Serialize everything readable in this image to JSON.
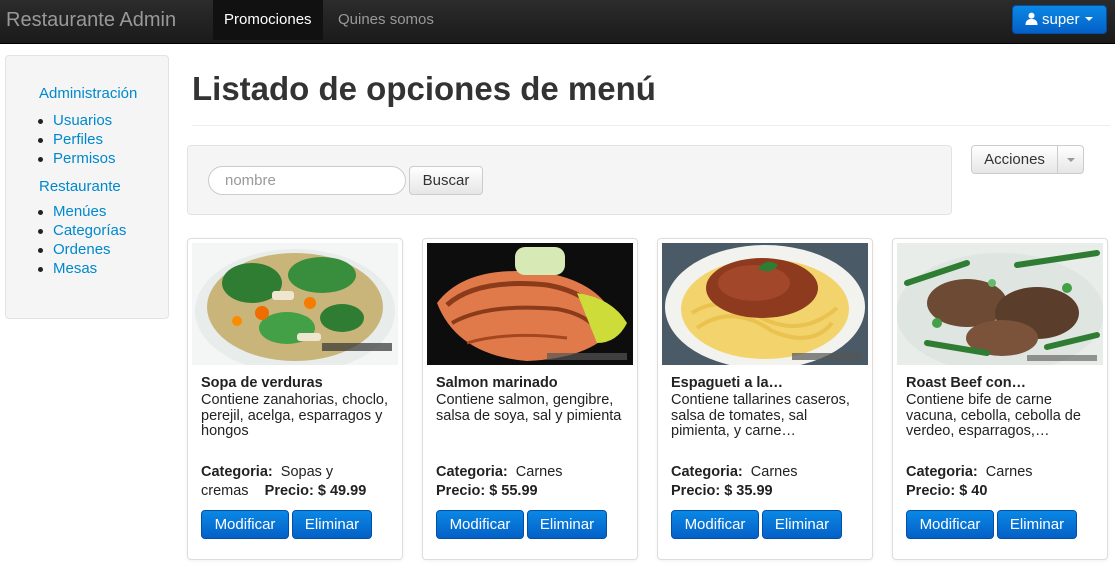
{
  "navbar": {
    "brand": "Restaurante Admin",
    "tabs": [
      {
        "label": "Promociones",
        "active": true
      },
      {
        "label": "Quines somos",
        "active": false
      }
    ],
    "user": "super"
  },
  "sidebar": {
    "sections": [
      {
        "header": "Administración",
        "items": [
          "Usuarios",
          "Perfiles",
          "Permisos"
        ]
      },
      {
        "header": "Restaurante",
        "items": [
          "Menúes",
          "Categorías",
          "Ordenes",
          "Mesas"
        ]
      }
    ]
  },
  "main": {
    "title": "Listado de opciones de menú",
    "search": {
      "placeholder": "nombre",
      "value": "",
      "button": "Buscar"
    },
    "actions_label": "Acciones",
    "category_label": "Categoria:",
    "price_label": "Precio:",
    "edit_label": "Modificar",
    "delete_label": "Eliminar",
    "items": [
      {
        "title": "Sopa de verduras",
        "description": "Contiene zanahorias, choclo, perejil, acelga, esparragos y hongos",
        "category": "Sopas y cremas",
        "price": "$ 49.99",
        "image": "soup-photo"
      },
      {
        "title": "Salmon marinado",
        "description": "Contiene salmon, gengibre, salsa de soya, sal y pimienta",
        "category": "Carnes",
        "price": "$ 55.99",
        "image": "salmon-photo"
      },
      {
        "title": "Espagueti a la…",
        "description": "Contiene tallarines caseros, salsa de tomates, sal pimienta, y carne…",
        "category": "Carnes",
        "price": "$ 35.99",
        "image": "spaghetti-photo"
      },
      {
        "title": "Roast Beef con…",
        "description": "Contiene bife de carne vacuna, cebolla, cebolla de verdeo, esparragos,…",
        "category": "Carnes",
        "price": "$ 40",
        "image": "roast-beef-photo"
      }
    ]
  },
  "colors": {
    "accent": "#0088cc",
    "primary_button": "#0460c7",
    "navbar": "#1b1b1b"
  }
}
